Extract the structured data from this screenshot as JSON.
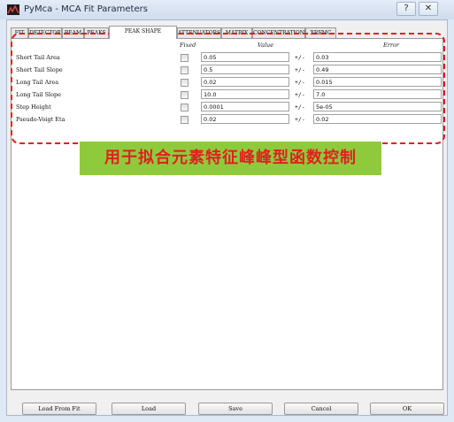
{
  "window": {
    "title": "PyMca - MCA Fit Parameters",
    "help_glyph": "?",
    "close_glyph": "✕"
  },
  "tabs": [
    "FIT",
    "DETECTOR",
    "BEAM",
    "PEAKS",
    "PEAK SHAPE",
    "ATTENUATORS",
    "MATRIX",
    "CONCENTRATIONS",
    "XRFMC"
  ],
  "active_tab": "PEAK SHAPE",
  "headers": {
    "fixed": "Fixed",
    "value": "Value",
    "error": "Error"
  },
  "pm_label": "+/-",
  "rows": [
    {
      "label": "Short Tail Area",
      "fixed": false,
      "value": "0.05",
      "error": "0.03"
    },
    {
      "label": "Short Tail Slope",
      "fixed": false,
      "value": "0.5",
      "error": "0.49"
    },
    {
      "label": "Long Tail Area",
      "fixed": false,
      "value": "0.02",
      "error": "0.015"
    },
    {
      "label": "Long Tail Slope",
      "fixed": false,
      "value": "10.0",
      "error": "7.0"
    },
    {
      "label": "Step Height",
      "fixed": false,
      "value": "0.0001",
      "error": "5e-05"
    },
    {
      "label": "Pseudo-Voigt Eta",
      "fixed": false,
      "value": "0.02",
      "error": "0.02"
    }
  ],
  "annotation": {
    "text": "用于拟合元素特征峰峰型函数控制",
    "box_color": "#e8161f",
    "banner_color": "#8fca3d",
    "text_color": "#e02020"
  },
  "buttons": {
    "load_from_fit": "Load From Fit",
    "load": "Load",
    "save": "Save",
    "cancel": "Cancel",
    "ok": "OK"
  }
}
